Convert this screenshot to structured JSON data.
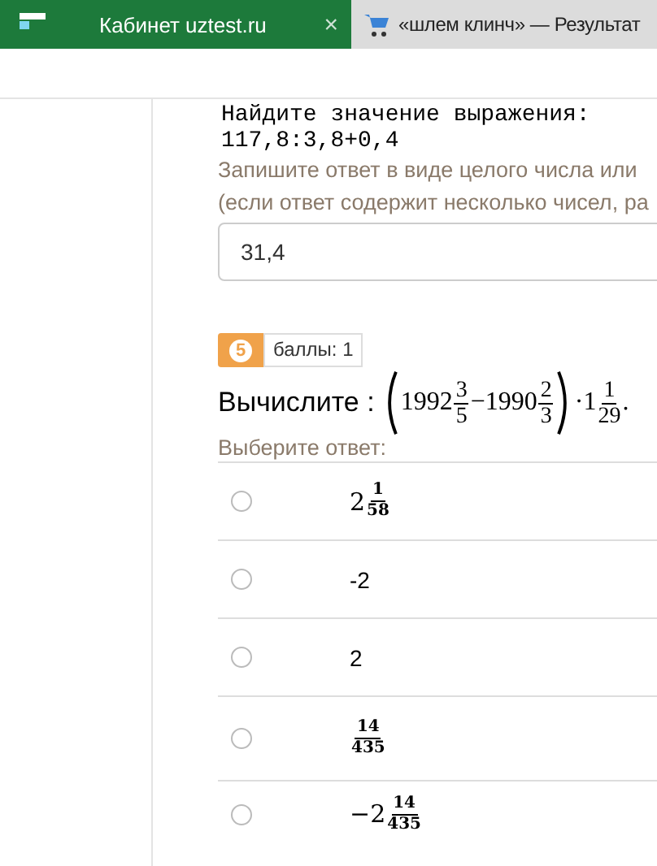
{
  "tabs": [
    {
      "title": "Кабинет uztest.ru",
      "selected": true,
      "close": "×"
    },
    {
      "title": "«шлем клинч» — Результат",
      "selected": false
    }
  ],
  "question_1": {
    "prompt": "Найдите значение выражения:",
    "expression": "117,8:3,8+0,4",
    "instruction": "Запишите ответ в виде целого числа или",
    "note": "(если ответ содержит несколько чисел, ра",
    "answer": "31,4"
  },
  "question_2": {
    "number": "5",
    "points": "баллы: 1",
    "label": "Вычислите :",
    "formula": [
      {
        "kind": "open"
      },
      {
        "kind": "text",
        "text": "1992"
      },
      {
        "kind": "fraction",
        "num": "3",
        "den": "5"
      },
      {
        "kind": "text",
        "text": "−1990"
      },
      {
        "kind": "fraction",
        "num": "2",
        "den": "3"
      },
      {
        "kind": "close"
      },
      {
        "kind": "text",
        "text": "·1"
      },
      {
        "kind": "fraction",
        "num": "1",
        "den": "29"
      },
      {
        "kind": "text",
        "text": "."
      }
    ],
    "choose": "Выберите ответ:",
    "options": [
      {
        "selected": false,
        "parts": [
          {
            "kind": "text",
            "text": "2"
          },
          {
            "kind": "fraction",
            "num": "1",
            "den": "58"
          }
        ]
      },
      {
        "selected": false,
        "parts": [
          {
            "kind": "plain",
            "text": "-2"
          }
        ]
      },
      {
        "selected": false,
        "parts": [
          {
            "kind": "plain",
            "text": "2"
          }
        ]
      },
      {
        "selected": false,
        "parts": [
          {
            "kind": "fraction",
            "num": "14",
            "den": "435"
          }
        ]
      },
      {
        "selected": false,
        "parts": [
          {
            "kind": "text",
            "text": "−2"
          },
          {
            "kind": "fraction",
            "num": "14",
            "den": "435"
          }
        ]
      }
    ]
  }
}
